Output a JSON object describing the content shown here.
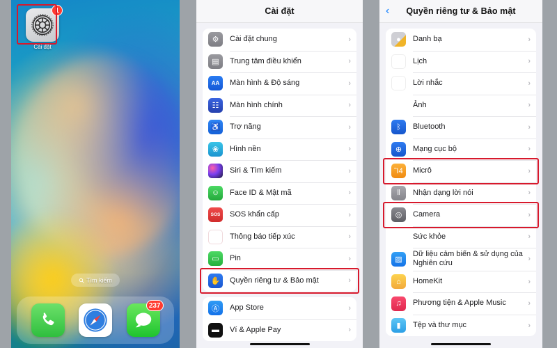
{
  "home": {
    "app": {
      "label": "Cài đặt",
      "badge": "1",
      "icon": "settings-gear-icon"
    },
    "search_pill": {
      "label": "Tìm kiếm",
      "icon": "search-icon"
    },
    "dock": [
      {
        "name": "phone",
        "icon": "phone-icon",
        "badge": ""
      },
      {
        "name": "safari",
        "icon": "compass-icon",
        "badge": ""
      },
      {
        "name": "messages",
        "icon": "message-bubble-icon",
        "badge": "237"
      }
    ]
  },
  "settings": {
    "title": "Cài đặt",
    "groups": [
      {
        "rows": [
          {
            "label": "Cài đặt chung",
            "icon": "gear-icon",
            "icon_class": "ic-gear",
            "glyph": "⚙",
            "highlight": false
          },
          {
            "label": "Trung tâm điều khiển",
            "icon": "control-center-icon",
            "icon_class": "ic-cc",
            "glyph": "▤",
            "highlight": false
          },
          {
            "label": "Màn hình & Độ sáng",
            "icon": "display-brightness-icon",
            "icon_class": "ic-aa",
            "glyph": "AA",
            "highlight": false
          },
          {
            "label": "Màn hình chính",
            "icon": "home-screen-icon",
            "icon_class": "ic-home2",
            "glyph": "☷",
            "highlight": false
          },
          {
            "label": "Trợ năng",
            "icon": "accessibility-icon",
            "icon_class": "ic-access",
            "glyph": "♿",
            "highlight": false
          },
          {
            "label": "Hình nền",
            "icon": "wallpaper-icon",
            "icon_class": "ic-wall",
            "glyph": "❀",
            "highlight": false
          },
          {
            "label": "Siri & Tìm kiếm",
            "icon": "siri-icon",
            "icon_class": "ic-siri",
            "glyph": "",
            "highlight": false
          },
          {
            "label": "Face ID & Mật mã",
            "icon": "face-id-icon",
            "icon_class": "ic-faceid",
            "glyph": "☺",
            "highlight": false
          },
          {
            "label": "SOS khẩn cấp",
            "icon": "sos-icon",
            "icon_class": "ic-sos",
            "glyph": "SOS",
            "highlight": false
          },
          {
            "label": "Thông báo tiếp xúc",
            "icon": "exposure-notification-icon",
            "icon_class": "ic-expo",
            "glyph": "☀",
            "highlight": false
          },
          {
            "label": "Pin",
            "icon": "battery-icon",
            "icon_class": "ic-batt",
            "glyph": "▭",
            "highlight": false
          },
          {
            "label": "Quyền riêng tư & Bảo mật",
            "icon": "privacy-hand-icon",
            "icon_class": "ic-priv",
            "glyph": "✋",
            "highlight": true
          }
        ]
      },
      {
        "rows": [
          {
            "label": "App Store",
            "icon": "app-store-icon",
            "icon_class": "ic-appstore",
            "glyph": "Ⓐ",
            "highlight": false
          },
          {
            "label": "Ví & Apple Pay",
            "icon": "wallet-icon",
            "icon_class": "ic-wallet",
            "glyph": "▬",
            "highlight": false
          }
        ]
      }
    ]
  },
  "privacy": {
    "title": "Quyền riêng tư & Bảo mật",
    "back_icon": "chevron-left-icon",
    "groups": [
      {
        "rows": [
          {
            "label": "Danh bạ",
            "icon": "contacts-icon",
            "icon_class": "ic-contacts",
            "glyph": "●",
            "highlight": false
          },
          {
            "label": "Lịch",
            "icon": "calendar-icon",
            "icon_class": "ic-cal",
            "glyph": "☷",
            "highlight": false
          },
          {
            "label": "Lời nhắc",
            "icon": "reminders-icon",
            "icon_class": "ic-rem",
            "glyph": "☰",
            "highlight": false
          },
          {
            "label": "Ảnh",
            "icon": "photos-icon",
            "icon_class": "ic-photos",
            "glyph": "✸",
            "highlight": false
          },
          {
            "label": "Bluetooth",
            "icon": "bluetooth-icon",
            "icon_class": "ic-bt",
            "glyph": "ᛒ",
            "highlight": false
          },
          {
            "label": "Mạng cục bộ",
            "icon": "local-network-icon",
            "icon_class": "ic-net",
            "glyph": "⊕",
            "highlight": false
          },
          {
            "label": "Micrô",
            "icon": "microphone-icon",
            "icon_class": "ic-mic2",
            "glyph": "Ἲ4",
            "highlight": true
          },
          {
            "label": "Nhận dạng lời nói",
            "icon": "speech-recognition-icon",
            "icon_class": "ic-speech",
            "glyph": "‖",
            "highlight": false
          },
          {
            "label": "Camera",
            "icon": "camera-icon",
            "icon_class": "ic-cam",
            "glyph": "◎",
            "highlight": true
          },
          {
            "label": "Sức khỏe",
            "icon": "health-heart-icon",
            "icon_class": "ic-health",
            "glyph": "♥",
            "highlight": false
          },
          {
            "label": "Dữ liệu cảm biến & sử dụng của Nghiên cứu",
            "icon": "research-sensor-icon",
            "icon_class": "ic-research",
            "glyph": "▨",
            "highlight": false
          },
          {
            "label": "HomeKit",
            "icon": "homekit-icon",
            "icon_class": "ic-homekit",
            "glyph": "⌂",
            "highlight": false
          },
          {
            "label": "Phương tiện & Apple Music",
            "icon": "apple-music-icon",
            "icon_class": "ic-music",
            "glyph": "♫",
            "highlight": false
          },
          {
            "label": "Tệp và thư mục",
            "icon": "files-folder-icon",
            "icon_class": "ic-files",
            "glyph": "▮",
            "highlight": false
          }
        ]
      }
    ]
  },
  "colors": {
    "highlight_red": "#d7192c",
    "ios_blue": "#0a7cff",
    "badge_red": "#ff3b30",
    "page_bg": "#9ea3a8",
    "list_bg": "#f2f2f7"
  }
}
